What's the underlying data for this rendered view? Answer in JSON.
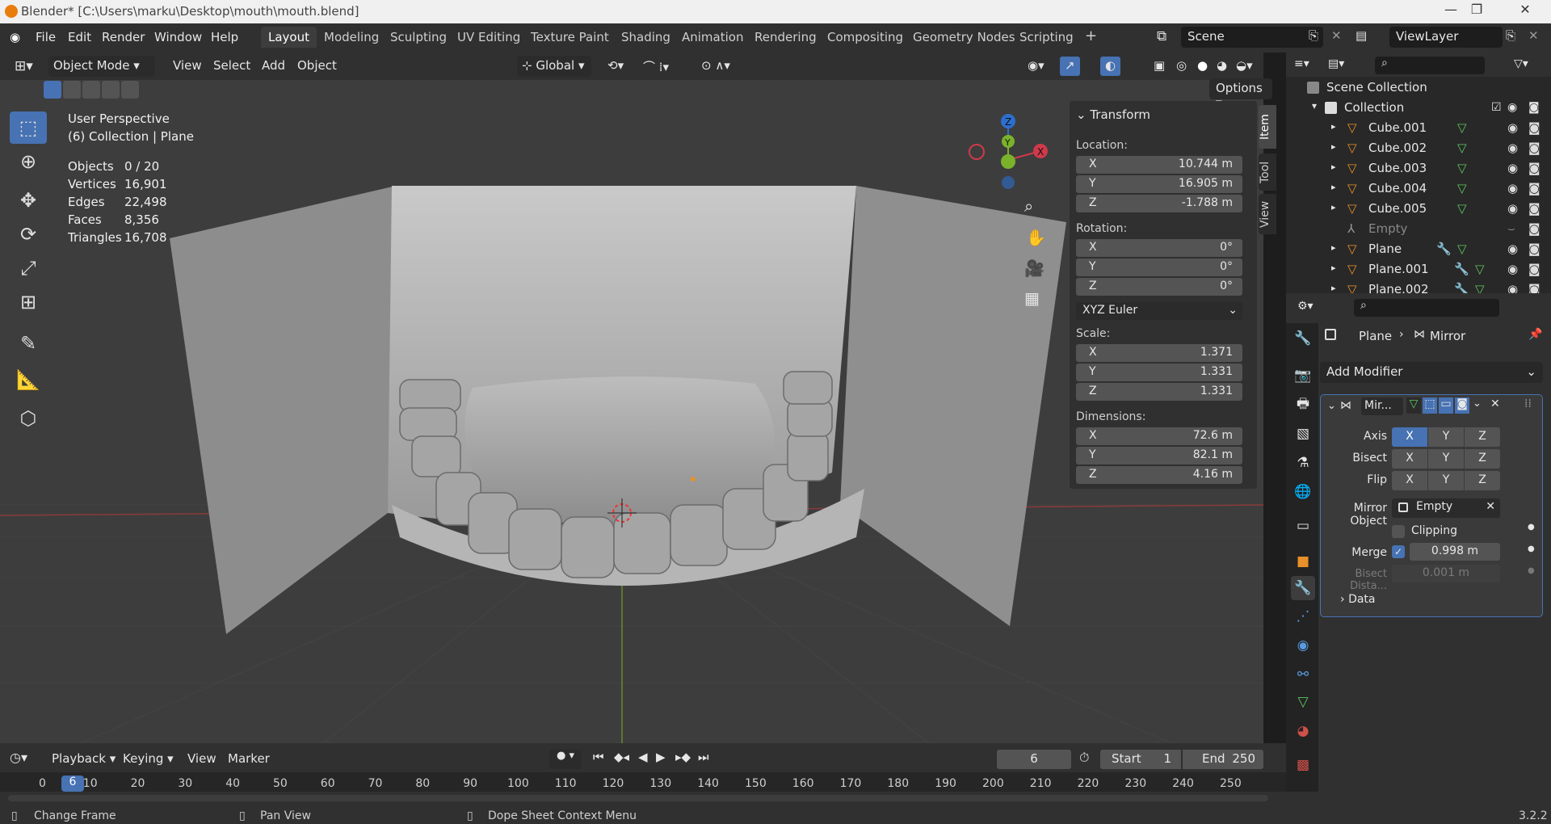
{
  "window": {
    "title": "Blender* [C:\\Users\\marku\\Desktop\\mouth\\mouth.blend]",
    "minimize": "—",
    "restore": "❐",
    "close": "✕"
  },
  "menubar": {
    "file": "File",
    "edit": "Edit",
    "render": "Render",
    "window": "Window",
    "help": "Help"
  },
  "workspaces": [
    "Layout",
    "Modeling",
    "Sculpting",
    "UV Editing",
    "Texture Paint",
    "Shading",
    "Animation",
    "Rendering",
    "Compositing",
    "Geometry Nodes",
    "Scripting"
  ],
  "add_workspace": "+",
  "scene": "Scene",
  "view_layer": "ViewLayer",
  "viewport": {
    "mode": "Object Mode",
    "view": "View",
    "select": "Select",
    "add": "Add",
    "object": "Object",
    "orientation": "Global",
    "options": "Options",
    "perspective": "User Perspective",
    "collection_info": "(6) Collection | Plane",
    "stats": [
      {
        "k": "Objects",
        "v": "0 / 20"
      },
      {
        "k": "Vertices",
        "v": "16,901"
      },
      {
        "k": "Edges",
        "v": "22,498"
      },
      {
        "k": "Faces",
        "v": "8,356"
      },
      {
        "k": "Triangles",
        "v": "16,708"
      }
    ],
    "gizmo": {
      "x": "X",
      "y": "Y",
      "z": "Z"
    }
  },
  "npanel": {
    "header": "Transform",
    "location_label": "Location:",
    "location": [
      {
        "a": "X",
        "v": "10.744 m"
      },
      {
        "a": "Y",
        "v": "16.905 m"
      },
      {
        "a": "Z",
        "v": "-1.788 m"
      }
    ],
    "rotation_label": "Rotation:",
    "rotation": [
      {
        "a": "X",
        "v": "0°"
      },
      {
        "a": "Y",
        "v": "0°"
      },
      {
        "a": "Z",
        "v": "0°"
      }
    ],
    "rotation_mode": "XYZ Euler",
    "scale_label": "Scale:",
    "scale": [
      {
        "a": "X",
        "v": "1.371"
      },
      {
        "a": "Y",
        "v": "1.331"
      },
      {
        "a": "Z",
        "v": "1.331"
      }
    ],
    "dimensions_label": "Dimensions:",
    "dimensions": [
      {
        "a": "X",
        "v": "72.6 m"
      },
      {
        "a": "Y",
        "v": "82.1 m"
      },
      {
        "a": "Z",
        "v": "4.16 m"
      }
    ],
    "tabs": [
      "Item",
      "Tool",
      "View"
    ]
  },
  "outliner": {
    "scene_collection": "Scene Collection",
    "collection": "Collection",
    "items": [
      "Cube.001",
      "Cube.002",
      "Cube.003",
      "Cube.004",
      "Cube.005",
      "Empty",
      "Plane",
      "Plane.001",
      "Plane.002"
    ]
  },
  "properties": {
    "object": "Plane",
    "modifier": "Mirror",
    "add_modifier": "Add Modifier",
    "mod_short": "Mir...",
    "axis_label": "Axis",
    "bisect_label": "Bisect",
    "flip_label": "Flip",
    "axes": [
      "X",
      "Y",
      "Z"
    ],
    "mirror_object_label": "Mirror Object",
    "mirror_object": "Empty",
    "clipping": "Clipping",
    "merge_label": "Merge",
    "merge_value": "0.998 m",
    "bisect_distance_label": "Bisect Dista...",
    "bisect_distance_value": "0.001 m",
    "data": "Data"
  },
  "timeline": {
    "playback": "Playback",
    "keying": "Keying",
    "view": "View",
    "marker": "Marker",
    "current_frame": "6",
    "start_label": "Start",
    "start": "1",
    "end_label": "End",
    "end": "250",
    "ticks": [
      "0",
      "10",
      "20",
      "30",
      "40",
      "50",
      "60",
      "70",
      "80",
      "90",
      "100",
      "110",
      "120",
      "130",
      "140",
      "150",
      "160",
      "170",
      "180",
      "190",
      "200",
      "210",
      "220",
      "230",
      "240",
      "250"
    ]
  },
  "status": {
    "change_frame": "Change Frame",
    "pan_view": "Pan View",
    "context_menu": "Dope Sheet Context Menu",
    "version": "3.2.2"
  }
}
